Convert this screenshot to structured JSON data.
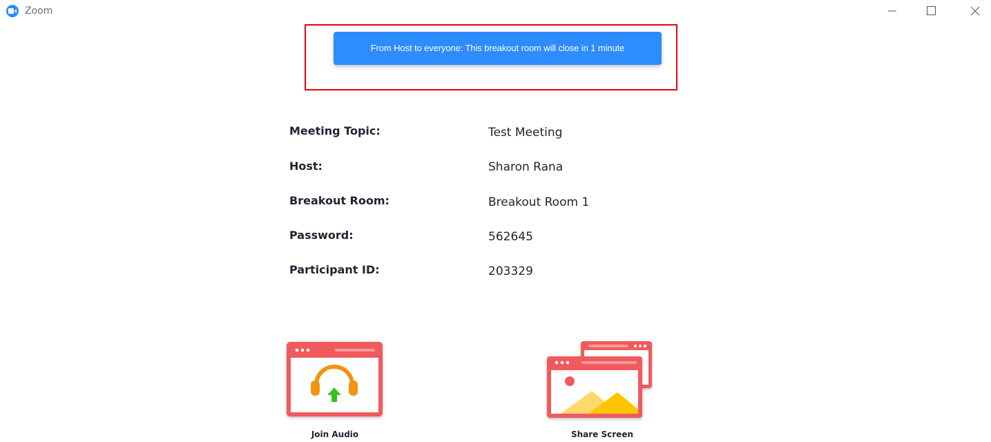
{
  "window": {
    "title": "Zoom",
    "icon": "zoom-camera-icon",
    "controls": [
      "minimize-icon",
      "maximize-icon",
      "close-icon"
    ]
  },
  "notification": {
    "message": "From Host to everyone: This breakout room will close in 1 minute",
    "color": "#2d8cff",
    "highlight_color": "#e3000f"
  },
  "meeting_info": [
    {
      "label": "Meeting Topic:",
      "value": "Test Meeting"
    },
    {
      "label": "Host:",
      "value": "Sharon Rana"
    },
    {
      "label": "Breakout Room:",
      "value": "Breakout Room 1"
    },
    {
      "label": "Password:",
      "value": "562645"
    },
    {
      "label": "Participant ID:",
      "value": "203329"
    }
  ],
  "actions": {
    "join_audio": {
      "label": "Join Audio",
      "icon": "headphones-icon"
    },
    "share_screen": {
      "label": "Share Screen",
      "icon": "share-screen-icon"
    }
  },
  "colors": {
    "accent": "#2d8cff",
    "tile_red": "#f15a5d",
    "headphones_orange": "#f29412",
    "arrow_green": "#39c31d",
    "mountain_yellow": "#ffc600",
    "mountain_light": "#ffd86b"
  }
}
